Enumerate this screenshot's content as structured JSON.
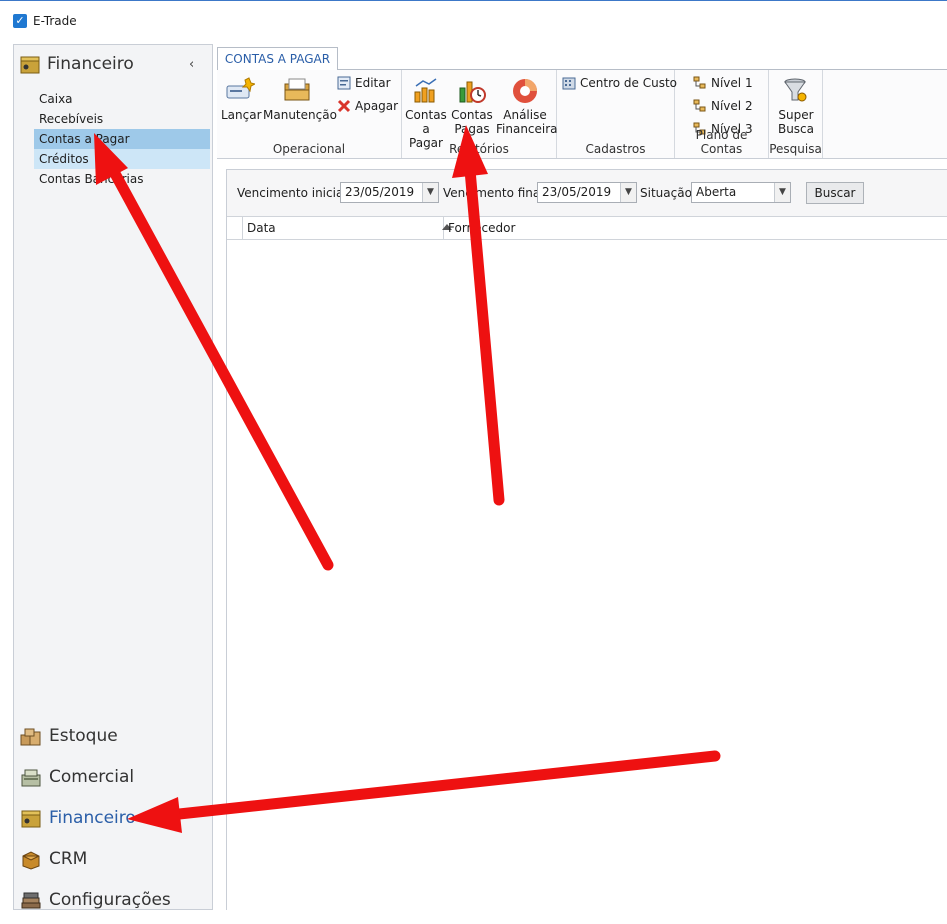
{
  "window": {
    "title": "E-Trade"
  },
  "sidebar": {
    "header": "Financeiro",
    "items": [
      {
        "label": "Caixa"
      },
      {
        "label": "Recebíveis"
      },
      {
        "label": "Contas a Pagar"
      },
      {
        "label": "Créditos"
      },
      {
        "label": "Contas Bancárias"
      }
    ],
    "modules": [
      {
        "label": "Estoque"
      },
      {
        "label": "Comercial"
      },
      {
        "label": "Financeiro"
      },
      {
        "label": "CRM"
      },
      {
        "label": "Configurações"
      }
    ]
  },
  "tab": {
    "label": "CONTAS A PAGAR"
  },
  "ribbon": {
    "operacional": {
      "label": "Operacional",
      "lancar": "Lançar",
      "manutencao": "Manutenção",
      "editar": "Editar",
      "apagar": "Apagar"
    },
    "relatorios": {
      "label": "Relatórios",
      "contas_pagar_1": "Contas",
      "contas_pagar_2": "a Pagar",
      "contas_pagas_1": "Contas",
      "contas_pagas_2": "Pagas",
      "analise_1": "Análise",
      "analise_2": "Financeira"
    },
    "cadastros": {
      "label": "Cadastros",
      "centro_custo": "Centro de Custo"
    },
    "plano_contas": {
      "label": "Plano de Contas",
      "nivel1": "Nível 1",
      "nivel2": "Nível 2",
      "nivel3": "Nível 3"
    },
    "pesquisa": {
      "label": "Pesquisa",
      "super_1": "Super",
      "super_2": "Busca"
    }
  },
  "filters": {
    "venc_inicial_label": "Vencimento inicial:",
    "venc_inicial_value": "23/05/2019",
    "venc_final_label": "Vencimento final:",
    "venc_final_value": "23/05/2019",
    "situacao_label": "Situação:",
    "situacao_value": "Aberta",
    "buscar_label": "Buscar"
  },
  "grid": {
    "columns": [
      "Data",
      "Fornecedor"
    ]
  },
  "colors": {
    "arrow": "#ee1111",
    "accent": "#2a5ea8",
    "selection": "#9ec9e9"
  }
}
